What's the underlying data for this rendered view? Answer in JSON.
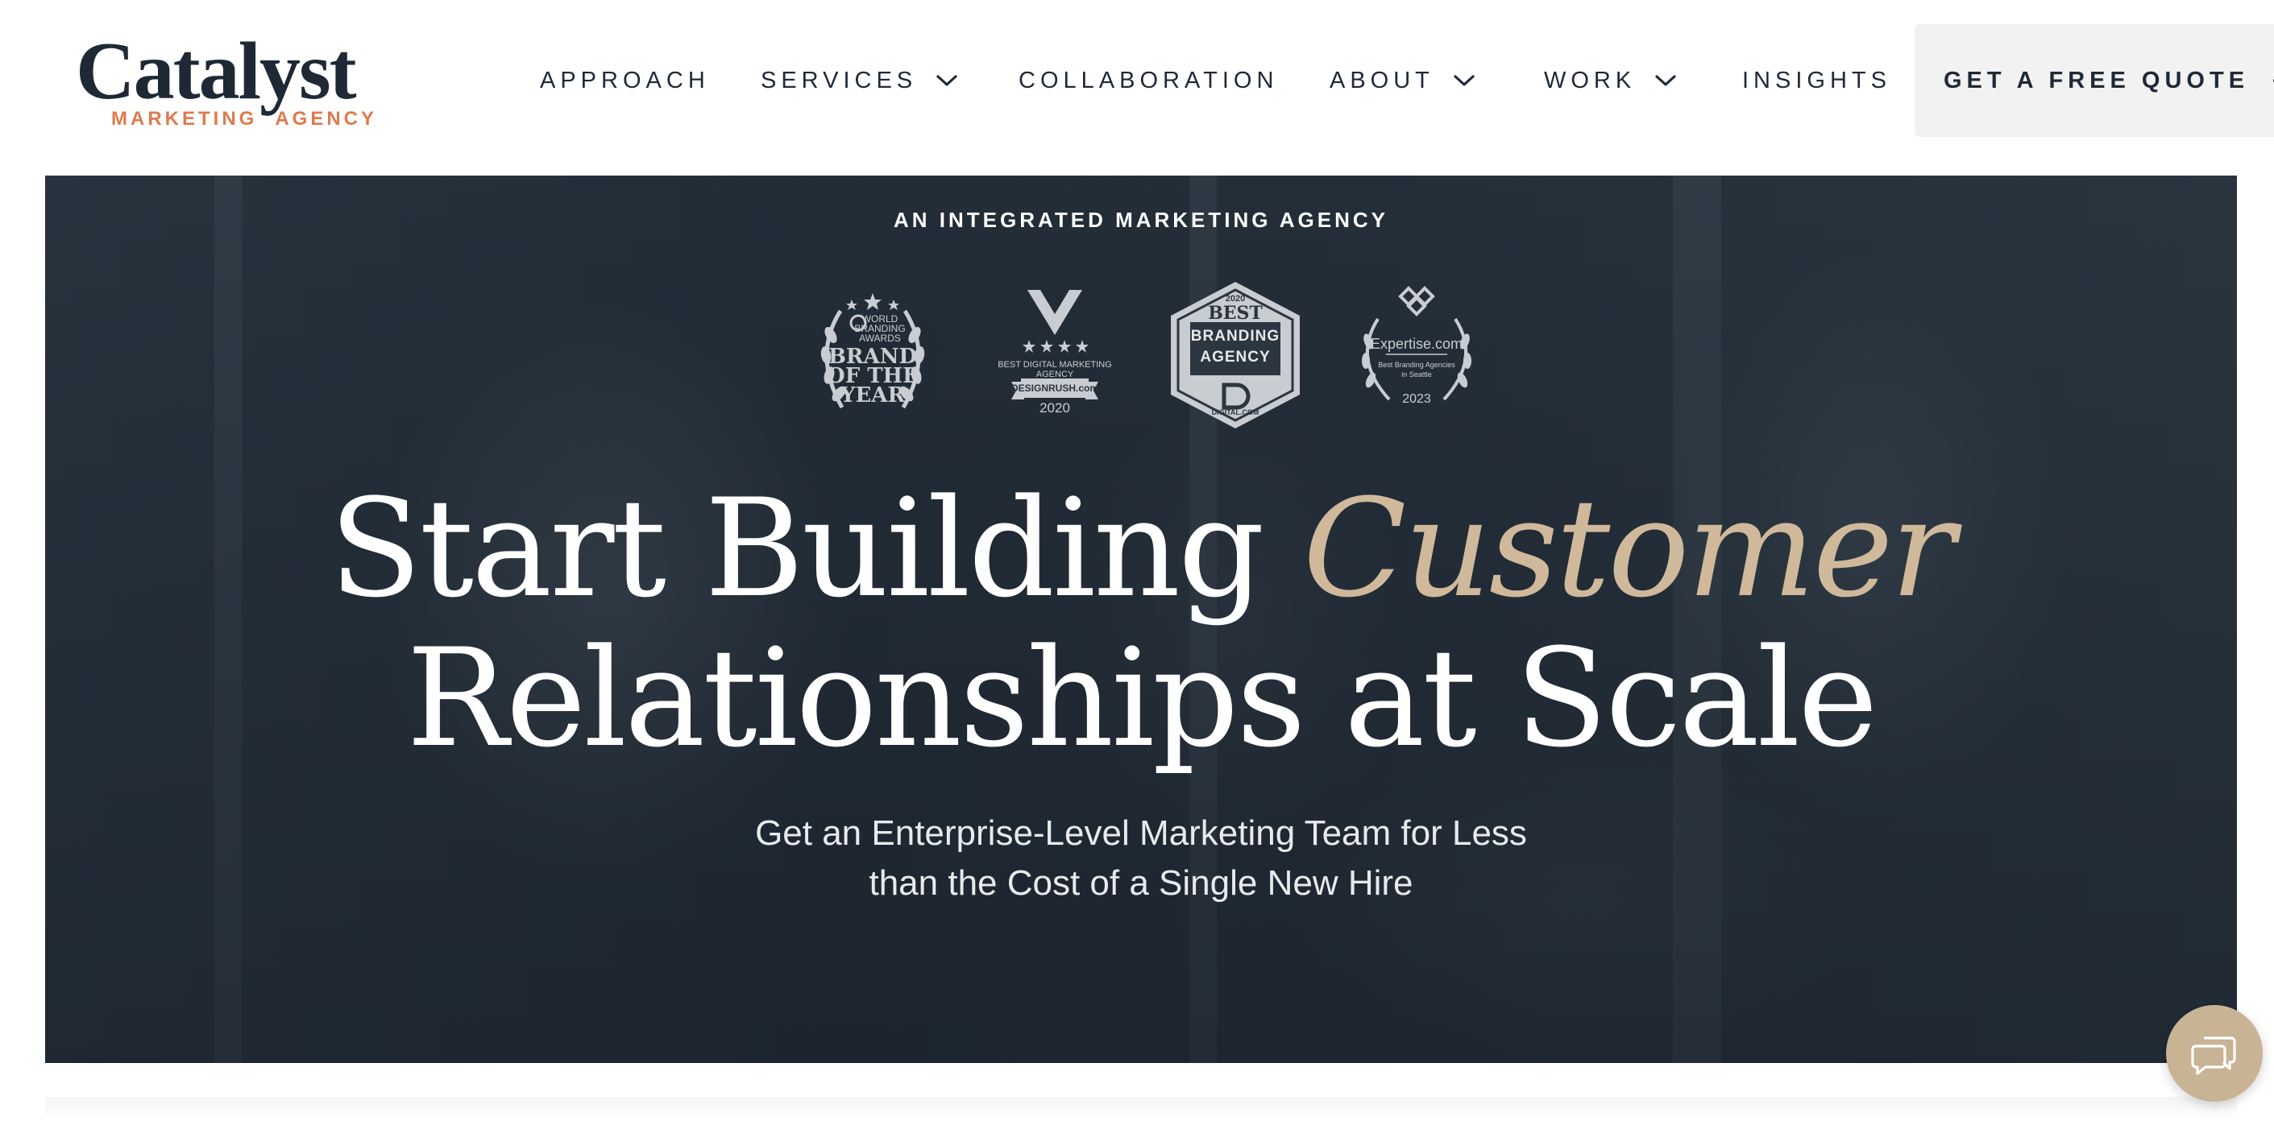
{
  "logo": {
    "name": "Catalyst",
    "tagline_left": "MARKETING",
    "tagline_right": "AGENCY",
    "accent_color": "#e0794f"
  },
  "nav": {
    "items": [
      {
        "label": "APPROACH",
        "has_dropdown": false
      },
      {
        "label": "SERVICES",
        "has_dropdown": true
      },
      {
        "label": "COLLABORATION",
        "has_dropdown": false
      },
      {
        "label": "ABOUT",
        "has_dropdown": true
      },
      {
        "label": "WORK",
        "has_dropdown": true
      },
      {
        "label": "INSIGHTS",
        "has_dropdown": false
      }
    ],
    "cta": {
      "label": "GET A FREE QUOTE",
      "icon": "arrow-right-icon"
    }
  },
  "hero": {
    "eyebrow": "AN INTEGRATED MARKETING AGENCY",
    "badges": [
      {
        "lines": [
          "WORLD",
          "BRANDING",
          "AWARDS",
          "BRAND",
          "OF THE",
          "YEAR"
        ],
        "icon": "laurel-wreath-icon"
      },
      {
        "lines": [
          "BEST DIGITAL MARKETING",
          "AGENCY",
          "DESIGNRUSH.com",
          "2020"
        ],
        "icon": "designrush-v-icon"
      },
      {
        "lines": [
          "2020",
          "BEST",
          "BRANDING",
          "AGENCY",
          "DIGITAL.COM"
        ],
        "icon": "hexagon-badge-icon"
      },
      {
        "lines": [
          "Expertise.com",
          "Best Branding Agencies",
          "in Seattle",
          "2023"
        ],
        "icon": "laurel-wreath-icon"
      }
    ],
    "headline_part1": "Start Building ",
    "headline_accent": "Customer",
    "headline_part2": "Relationships at Scale",
    "subhead_line1": "Get an Enterprise-Level Marketing Team for Less",
    "subhead_line2": "than the Cost of a Single New Hire",
    "accent_color": "#d0b99a"
  },
  "chat": {
    "icon": "chat-bubbles-icon",
    "color": "#c8b394"
  }
}
